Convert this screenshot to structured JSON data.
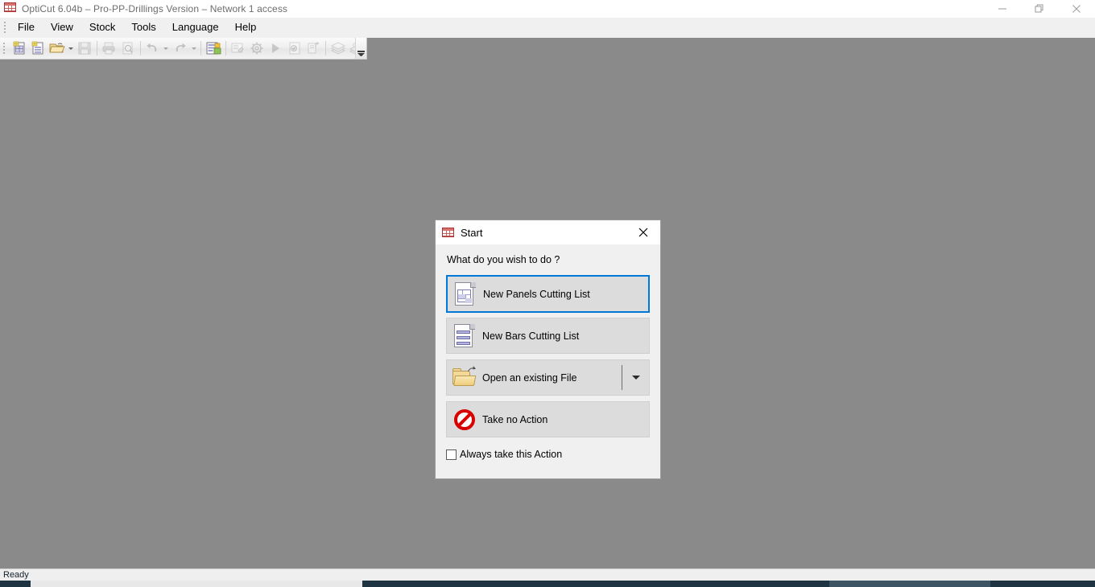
{
  "window": {
    "title": "OptiCut 6.04b – Pro-PP-Drillings Version – Network 1 access",
    "icon": "cutting-grid-icon",
    "controls": {
      "minimize": "Minimize",
      "restore": "Restore",
      "close": "Close"
    }
  },
  "menu": {
    "items": [
      {
        "label": "File"
      },
      {
        "label": "View"
      },
      {
        "label": "Stock"
      },
      {
        "label": "Tools"
      },
      {
        "label": "Language"
      },
      {
        "label": "Help"
      }
    ]
  },
  "toolbar": {
    "buttons": [
      {
        "name": "new-panels-list-icon",
        "enabled": true
      },
      {
        "name": "new-bars-list-icon",
        "enabled": true
      },
      {
        "name": "open-file-icon",
        "enabled": true,
        "has_dropdown": true
      },
      {
        "name": "save-icon",
        "enabled": false
      },
      {
        "name": "print-icon",
        "enabled": false
      },
      {
        "name": "print-preview-icon",
        "enabled": false
      },
      {
        "name": "undo-icon",
        "enabled": false,
        "has_dropdown": true
      },
      {
        "name": "redo-icon",
        "enabled": false,
        "has_dropdown": true
      },
      {
        "name": "optimize-icon",
        "enabled": true
      },
      {
        "name": "edit-list-icon",
        "enabled": false
      },
      {
        "name": "settings-gear-icon",
        "enabled": false
      },
      {
        "name": "run-play-icon",
        "enabled": false
      },
      {
        "name": "validate-icon",
        "enabled": false
      },
      {
        "name": "export-icon",
        "enabled": false
      },
      {
        "name": "panels-stack-icon",
        "enabled": false
      },
      {
        "name": "bars-stack-icon",
        "enabled": false
      }
    ],
    "overflow_label": "More buttons"
  },
  "status_bar": {
    "message": "Ready"
  },
  "dialog": {
    "title": "Start",
    "icon": "cutting-grid-icon",
    "close_label": "Close",
    "question": "What do you wish to do ?",
    "actions": [
      {
        "label": "New Panels Cutting List",
        "icon": "new-panels-document-icon",
        "selected": true,
        "has_dropdown": false
      },
      {
        "label": "New Bars Cutting List",
        "icon": "new-bars-document-icon",
        "selected": false,
        "has_dropdown": false
      },
      {
        "label": "Open an existing File",
        "icon": "open-folder-icon",
        "selected": false,
        "has_dropdown": true
      },
      {
        "label": "Take no Action",
        "icon": "no-action-prohibition-icon",
        "selected": false,
        "has_dropdown": false
      }
    ],
    "checkbox": {
      "label": "Always take this Action",
      "checked": false
    }
  },
  "colors": {
    "accent_selection": "#0078d7",
    "window_background": "#8a8a8a",
    "dialog_background": "#f0f0f0",
    "button_face": "#dcdcdc",
    "danger_red": "#d80000",
    "taskbar": "#1f3443"
  }
}
